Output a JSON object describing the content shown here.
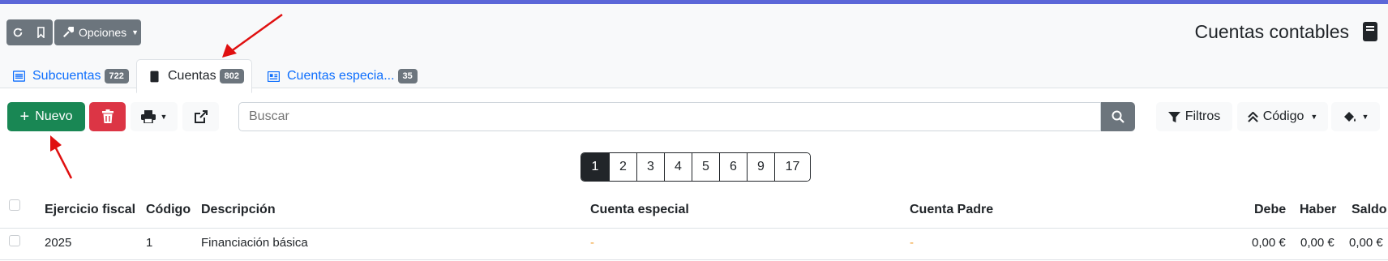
{
  "header": {
    "options_label": "Opciones",
    "title": "Cuentas contables"
  },
  "tabs": [
    {
      "label": "Subcuentas",
      "count": "722",
      "icon": "list-icon"
    },
    {
      "label": "Cuentas",
      "count": "802",
      "icon": "book-icon"
    },
    {
      "label": "Cuentas especia...",
      "count": "35",
      "icon": "newspaper-icon"
    }
  ],
  "toolbar": {
    "new_label": "Nuevo",
    "search_placeholder": "Buscar",
    "filters_label": "Filtros",
    "sort_label": "Código"
  },
  "pagination": [
    "1",
    "2",
    "3",
    "4",
    "5",
    "6",
    "9",
    "17"
  ],
  "table": {
    "columns": [
      "Ejercicio fiscal",
      "Código",
      "Descripción",
      "Cuenta especial",
      "Cuenta Padre",
      "Debe",
      "Haber",
      "Saldo"
    ],
    "rows": [
      {
        "ejercicio": "2025",
        "codigo": "1",
        "descripcion": "Financiación básica",
        "especial": "-",
        "padre": "-",
        "debe": "0,00 €",
        "haber": "0,00 €",
        "saldo": "0,00 €"
      }
    ]
  },
  "colors": {
    "accent": "#5c67d8",
    "success": "#198754",
    "danger": "#dc3545",
    "secondary": "#6c757d"
  }
}
